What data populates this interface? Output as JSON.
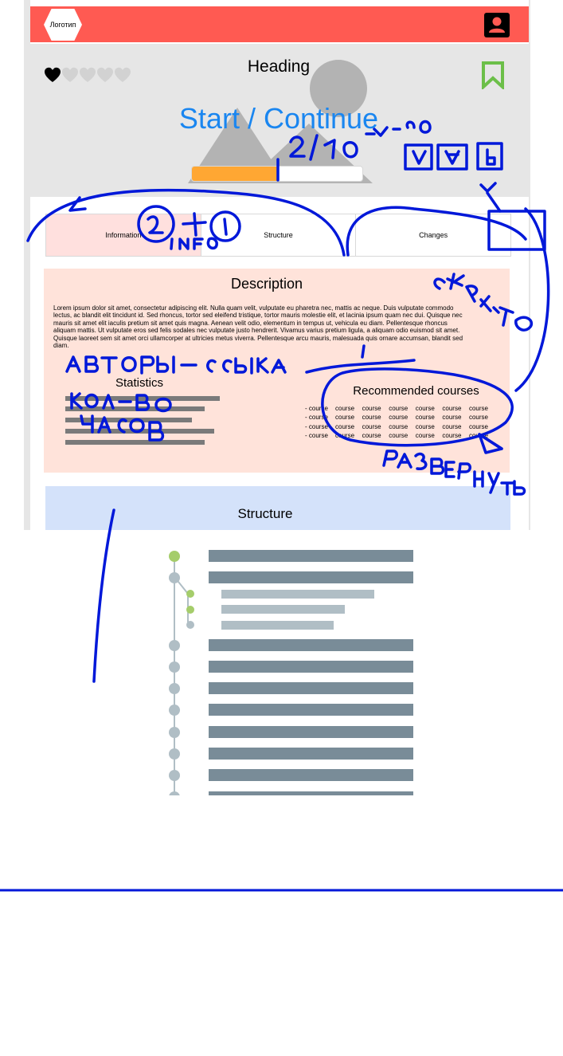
{
  "header": {
    "logo_text": "Логотип",
    "profile_icon": "user-icon"
  },
  "hero": {
    "rating": {
      "filled": 1,
      "total": 5
    },
    "title": "Heading",
    "start_label": "Start / Continue",
    "progress": 0.5,
    "bookmark_icon": "bookmark-icon"
  },
  "tabs": [
    {
      "label": "Information",
      "active": true
    },
    {
      "label": "Structure",
      "active": false
    },
    {
      "label": "Changes",
      "active": false
    }
  ],
  "description": {
    "title": "Description",
    "text": "Lorem ipsum dolor sit amet, consectetur adipiscing elit. Nulla quam velit, vulputate eu pharetra nec, mattis ac neque. Duis vulputate commodo lectus, ac blandit elit tincidunt id. Sed rhoncus, tortor sed eleifend tristique, tortor mauris molestie elit, et lacinia ipsum quam nec dui. Quisque nec mauris sit amet elit iaculis pretium sit amet quis magna. Aenean velit odio, elementum in tempus ut, vehicula eu diam. Pellentesque rhoncus aliquam mattis. Ut vulputate eros sed felis sodales nec vulputate justo hendrerit. Vivamus varius pretium ligula, a aliquam odio euismod sit amet. Quisque laoreet sem sit amet orci ullamcorper at ultricies metus viverra. Pellentesque arcu mauris, malesuada quis ornare accumsan, blandit sed diam."
  },
  "statistics": {
    "title": "Statistics"
  },
  "recommended": {
    "title": "Recommended courses",
    "rows": [
      [
        "- course",
        "course",
        "course",
        "course",
        "course",
        "course",
        "course"
      ],
      [
        "- course",
        "course",
        "course",
        "course",
        "course",
        "course",
        "course"
      ],
      [
        "- course",
        "course",
        "course",
        "course",
        "course",
        "course",
        "course"
      ],
      [
        "- course",
        "course",
        "course",
        "course",
        "course",
        "course",
        "course"
      ]
    ]
  },
  "structure": {
    "title": "Structure"
  },
  "annotations": {
    "counter": "2/10",
    "counter_suffix": "ЭТАПОВ",
    "tabs_note": "2 + 1",
    "tabs_note_sub": "INFO",
    "authors": "АВТОРЫ - ССЫЛКА",
    "hours": "КОЛ-ВО ЧАСОВ",
    "hide": "СКРЫТО",
    "expand": "РАЗВЕРНУТЬ",
    "ink_color": "#0018d9"
  },
  "colors": {
    "topbar": "#ff5a52",
    "accent_blue": "#1a86f0",
    "progress": "#ffa733",
    "bookmark": "#6cbf49",
    "info_bg": "#ffe3da",
    "structure_bg": "#d4e2fa",
    "timeline_done": "#a5cd6b",
    "timeline_pending": "#b0bec5"
  }
}
